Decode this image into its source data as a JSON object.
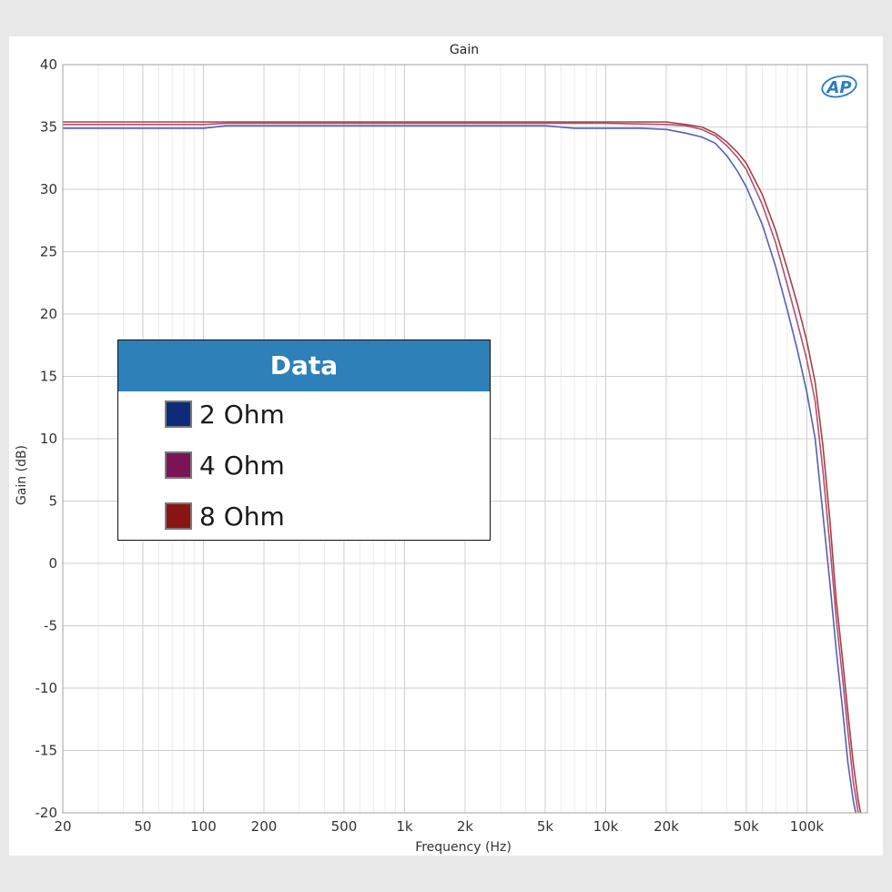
{
  "chart_data": {
    "type": "line",
    "title": "Gain",
    "xlabel": "Frequency (Hz)",
    "ylabel": "Gain (dB)",
    "x_scale": "log",
    "xlim": [
      20,
      200000
    ],
    "ylim": [
      -20,
      40
    ],
    "grid": true,
    "x_ticks": [
      20,
      50,
      100,
      200,
      500,
      1000,
      2000,
      5000,
      10000,
      20000,
      50000,
      100000
    ],
    "x_tick_labels": [
      "20",
      "50",
      "100",
      "200",
      "500",
      "1k",
      "2k",
      "5k",
      "10k",
      "20k",
      "50k",
      "100k"
    ],
    "y_ticks": [
      40,
      35,
      30,
      25,
      20,
      15,
      10,
      5,
      0,
      -5,
      -10,
      -15,
      -20
    ],
    "y_tick_labels": [
      "40",
      "35",
      "30",
      "25",
      "20",
      "15",
      "10",
      "5",
      "0",
      "-5",
      "-10",
      "-15",
      "-20"
    ],
    "legend": {
      "title": "Data",
      "position": "center-left"
    },
    "logo_text": "AP",
    "series": [
      {
        "name": "2 Ohm",
        "color": "#5560b4",
        "swatch": "#0f2a78",
        "points": [
          [
            20,
            34.9
          ],
          [
            100,
            34.9
          ],
          [
            130,
            35.1
          ],
          [
            1000,
            35.1
          ],
          [
            5000,
            35.1
          ],
          [
            7000,
            34.9
          ],
          [
            15000,
            34.9
          ],
          [
            20000,
            34.8
          ],
          [
            25000,
            34.5
          ],
          [
            30000,
            34.2
          ],
          [
            35000,
            33.7
          ],
          [
            40000,
            32.7
          ],
          [
            45000,
            31.5
          ],
          [
            50000,
            30.2
          ],
          [
            60000,
            27.2
          ],
          [
            70000,
            23.8
          ],
          [
            80000,
            20.3
          ],
          [
            90000,
            17.0
          ],
          [
            100000,
            13.7
          ],
          [
            110000,
            10.0
          ],
          [
            120000,
            4.0
          ],
          [
            130000,
            -1.5
          ],
          [
            140000,
            -7.0
          ],
          [
            150000,
            -11.5
          ],
          [
            160000,
            -16.0
          ],
          [
            170000,
            -19.0
          ],
          [
            175000,
            -20.0
          ]
        ]
      },
      {
        "name": "4 Ohm",
        "color": "#b0507a",
        "swatch": "#7a1455",
        "points": [
          [
            20,
            35.2
          ],
          [
            100,
            35.2
          ],
          [
            130,
            35.3
          ],
          [
            1000,
            35.3
          ],
          [
            5000,
            35.3
          ],
          [
            10000,
            35.3
          ],
          [
            20000,
            35.2
          ],
          [
            25000,
            35.1
          ],
          [
            30000,
            34.8
          ],
          [
            35000,
            34.3
          ],
          [
            40000,
            33.5
          ],
          [
            45000,
            32.6
          ],
          [
            50000,
            31.6
          ],
          [
            60000,
            28.8
          ],
          [
            70000,
            25.7
          ],
          [
            80000,
            22.3
          ],
          [
            90000,
            19.2
          ],
          [
            100000,
            16.3
          ],
          [
            110000,
            13.0
          ],
          [
            120000,
            7.5
          ],
          [
            130000,
            1.5
          ],
          [
            140000,
            -4.5
          ],
          [
            150000,
            -9.0
          ],
          [
            160000,
            -13.5
          ],
          [
            170000,
            -17.5
          ],
          [
            180000,
            -20.0
          ]
        ]
      },
      {
        "name": "8 Ohm",
        "color": "#a8403e",
        "swatch": "#8a1414",
        "points": [
          [
            20,
            35.4
          ],
          [
            100,
            35.4
          ],
          [
            130,
            35.4
          ],
          [
            1000,
            35.4
          ],
          [
            5000,
            35.4
          ],
          [
            10000,
            35.4
          ],
          [
            20000,
            35.4
          ],
          [
            25000,
            35.2
          ],
          [
            30000,
            35.0
          ],
          [
            35000,
            34.5
          ],
          [
            40000,
            33.8
          ],
          [
            45000,
            33.0
          ],
          [
            50000,
            32.1
          ],
          [
            60000,
            29.6
          ],
          [
            70000,
            26.7
          ],
          [
            80000,
            23.6
          ],
          [
            90000,
            20.7
          ],
          [
            100000,
            17.8
          ],
          [
            110000,
            14.5
          ],
          [
            120000,
            9.5
          ],
          [
            130000,
            3.5
          ],
          [
            140000,
            -3.0
          ],
          [
            150000,
            -7.5
          ],
          [
            160000,
            -12.0
          ],
          [
            170000,
            -16.0
          ],
          [
            180000,
            -19.0
          ],
          [
            185000,
            -20.0
          ]
        ]
      }
    ]
  }
}
